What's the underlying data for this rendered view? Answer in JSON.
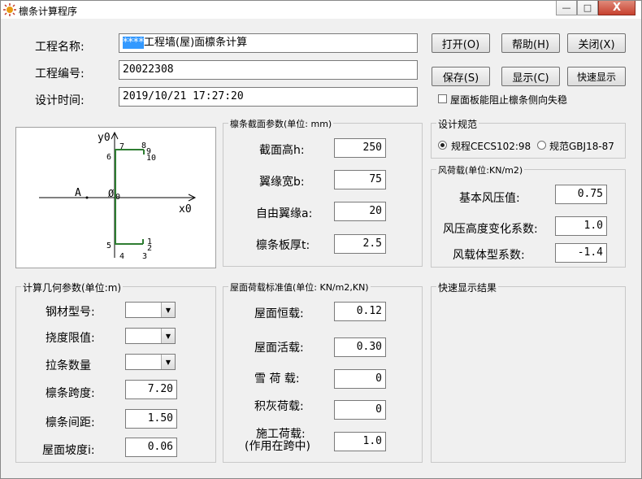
{
  "window": {
    "title": "檩条计算程序",
    "close_glyph": "X",
    "min_glyph": "—",
    "max_glyph": "□"
  },
  "project": {
    "name_label": "工程名称:",
    "name_selected": "****",
    "name_rest": "工程墙(屋)面檩条计算",
    "number_label": "工程编号:",
    "number_value": "20022308",
    "time_label": "设计时间:",
    "time_value": "2019/10/21 17:27:20"
  },
  "buttons": {
    "open": "打开(O)",
    "help": "帮助(H)",
    "close": "关闭(X)",
    "save": "保存(S)",
    "display": "显示(C)",
    "quick_display": "快速显示"
  },
  "roof_check_label": "屋面板能阻止檩条侧向失稳",
  "diagram": {
    "y_axis": "y0",
    "x_axis": "x0",
    "origin": "0",
    "shear_center": "A",
    "centroid_mark": "Ø",
    "points": [
      "1",
      "2",
      "3",
      "4",
      "5",
      "6",
      "7",
      "8",
      "9",
      "10"
    ]
  },
  "section": {
    "title": "檩条截面参数(单位: mm)",
    "height_label": "截面高h:",
    "height_value": "250",
    "flange_label": "翼缘宽b:",
    "flange_value": "75",
    "free_label": "自由翼缘a:",
    "free_value": "20",
    "thick_label": "檩条板厚t:",
    "thick_value": "2.5"
  },
  "code": {
    "title": "设计规范",
    "opt1": "规程CECS102:98",
    "opt2": "规范GBJ18-87"
  },
  "wind": {
    "title": "风荷载(单位:KN/m2)",
    "basic_label": "基本风压值:",
    "basic_value": "0.75",
    "height_label": "风压高度变化系数:",
    "height_value": "1.0",
    "shape_label": "风载体型系数:",
    "shape_value": "-1.4"
  },
  "geometry": {
    "title": "计算几何参数(单位:m)",
    "steel_label": "钢材型号:",
    "deflection_label": "挠度限值:",
    "tie_label": "拉条数量",
    "span_label": "檩条跨度:",
    "span_value": "7.20",
    "spacing_label": "檩条间距:",
    "spacing_value": "1.50",
    "slope_label": "屋面坡度i:",
    "slope_value": "0.06"
  },
  "loads": {
    "title": "屋面荷载标准值(单位: KN/m2,KN)",
    "dead_label": "屋面恒载:",
    "dead_value": "0.12",
    "live_label": "屋面活载:",
    "live_value": "0.30",
    "snow_label": "雪 荷 载:",
    "snow_value": "0",
    "ash_label": "积灰荷载:",
    "ash_value": "0",
    "const_label1": "施工荷载:",
    "const_label2": "(作用在跨中)",
    "const_value": "1.0"
  },
  "quick": {
    "title": "快速显示结果"
  }
}
